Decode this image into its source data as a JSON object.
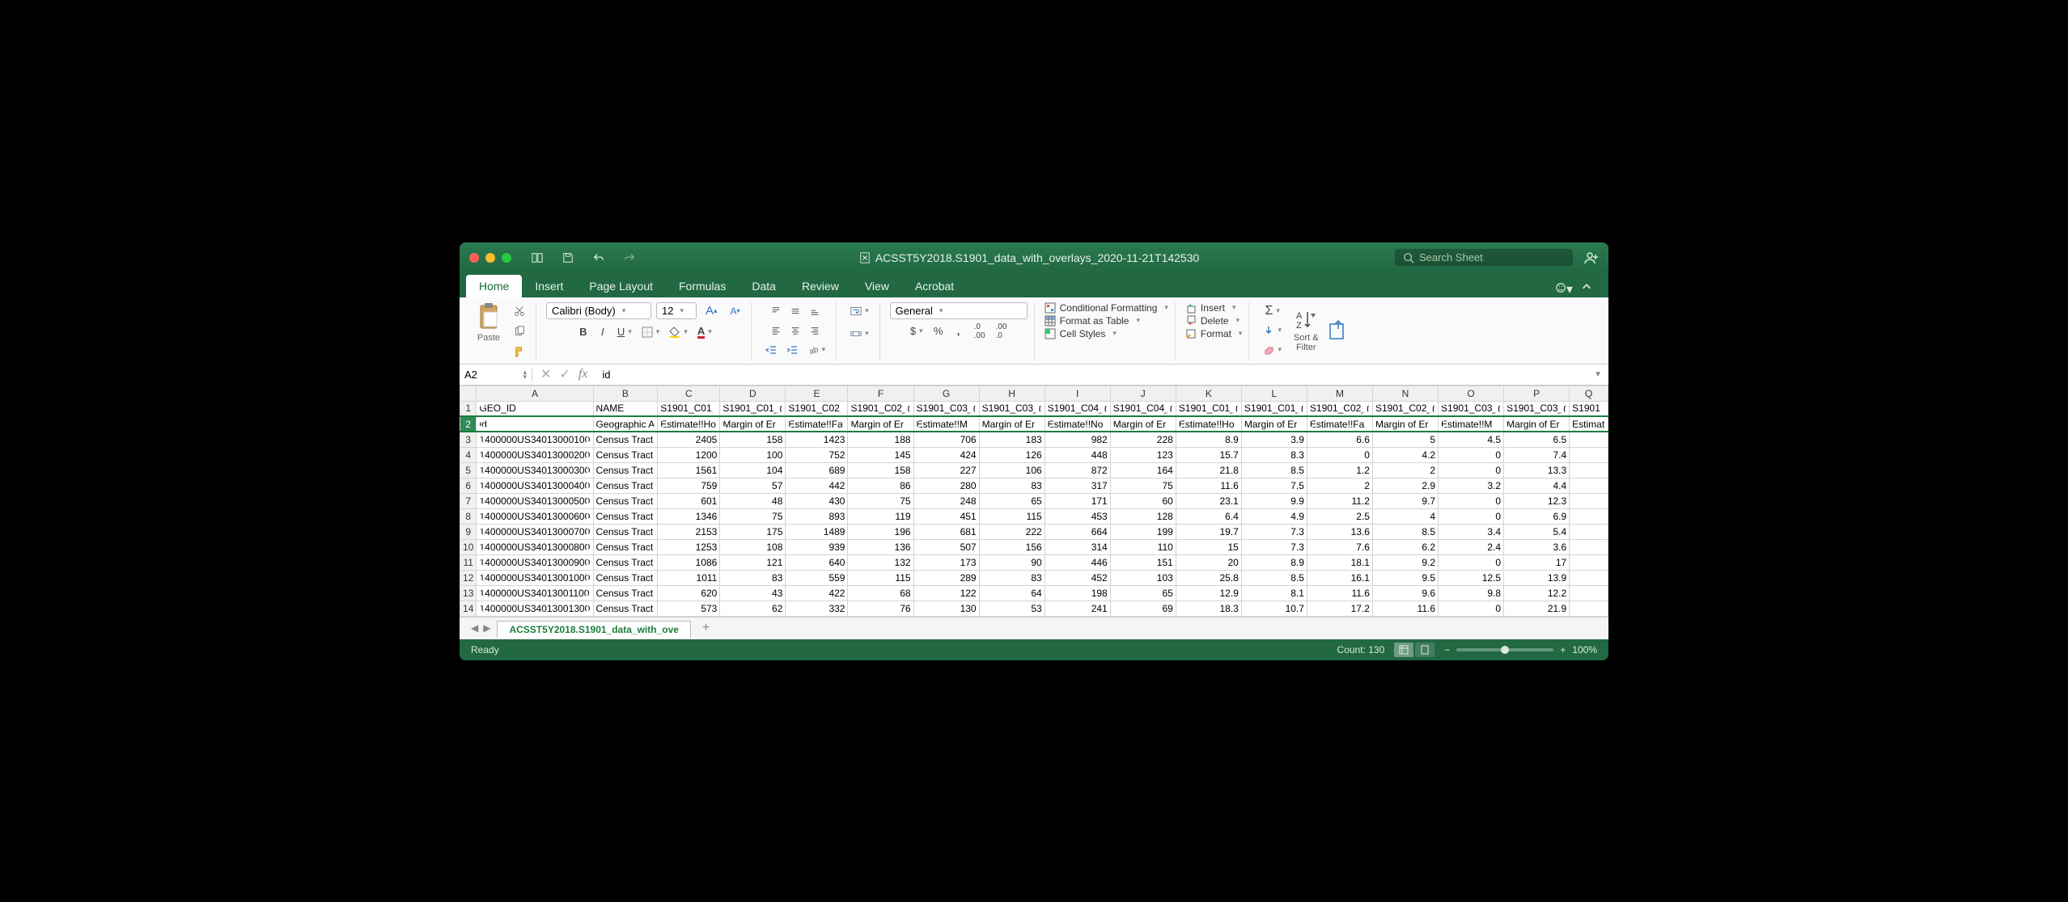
{
  "title": "ACSST5Y2018.S1901_data_with_overlays_2020-11-21T142530",
  "search_placeholder": "Search Sheet",
  "tabs": [
    "Home",
    "Insert",
    "Page Layout",
    "Formulas",
    "Data",
    "Review",
    "View",
    "Acrobat"
  ],
  "active_tab": "Home",
  "clipboard_label": "Paste",
  "font_name": "Calibri (Body)",
  "font_size": "12",
  "number_format": "General",
  "styles": {
    "cond": "Conditional Formatting",
    "table": "Format as Table",
    "cell": "Cell Styles"
  },
  "cell_ops": {
    "ins": "Insert",
    "del": "Delete",
    "fmt": "Format"
  },
  "sort_label": "Sort &\nFilter",
  "cell_ref": "A2",
  "formula_value": "id",
  "columns": [
    "A",
    "B",
    "C",
    "D",
    "E",
    "F",
    "G",
    "H",
    "I",
    "J",
    "K",
    "L",
    "M",
    "N",
    "O",
    "P",
    "Q"
  ],
  "col_widths": {
    "A": 155,
    "B": 80
  },
  "header_row": [
    "GEO_ID",
    "NAME",
    "S1901_C01_",
    "S1901_C01_(",
    "S1901_C02_",
    "S1901_C02_(",
    "S1901_C03_(",
    "S1901_C03_(",
    "S1901_C04_(",
    "S1901_C04_(",
    "S1901_C01_(",
    "S1901_C01_(",
    "S1901_C02_(",
    "S1901_C02_(",
    "S1901_C03_(",
    "S1901_C03_(",
    "S1901"
  ],
  "label_row": [
    "id",
    "Geographic A",
    "Estimate!!Ho",
    "Margin of Er",
    "Estimate!!Fa",
    "Margin of Er",
    "Estimate!!M",
    "Margin of Er",
    "Estimate!!No",
    "Margin of Er",
    "Estimate!!Ho",
    "Margin of Er",
    "Estimate!!Fa",
    "Margin of Er",
    "Estimate!!M",
    "Margin of Er",
    "Estimat"
  ],
  "rows": [
    {
      "n": 3,
      "cells": [
        "1400000US34013000100",
        "Census Tract",
        "2405",
        "158",
        "1423",
        "188",
        "706",
        "183",
        "982",
        "228",
        "8.9",
        "3.9",
        "6.6",
        "5",
        "4.5",
        "6.5",
        ""
      ]
    },
    {
      "n": 4,
      "cells": [
        "1400000US34013000200",
        "Census Tract",
        "1200",
        "100",
        "752",
        "145",
        "424",
        "126",
        "448",
        "123",
        "15.7",
        "8.3",
        "0",
        "4.2",
        "0",
        "7.4",
        ""
      ]
    },
    {
      "n": 5,
      "cells": [
        "1400000US34013000300",
        "Census Tract",
        "1561",
        "104",
        "689",
        "158",
        "227",
        "106",
        "872",
        "164",
        "21.8",
        "8.5",
        "1.2",
        "2",
        "0",
        "13.3",
        ""
      ]
    },
    {
      "n": 6,
      "cells": [
        "1400000US34013000400",
        "Census Tract",
        "759",
        "57",
        "442",
        "86",
        "280",
        "83",
        "317",
        "75",
        "11.6",
        "7.5",
        "2",
        "2.9",
        "3.2",
        "4.4",
        ""
      ]
    },
    {
      "n": 7,
      "cells": [
        "1400000US34013000500",
        "Census Tract",
        "601",
        "48",
        "430",
        "75",
        "248",
        "65",
        "171",
        "60",
        "23.1",
        "9.9",
        "11.2",
        "9.7",
        "0",
        "12.3",
        ""
      ]
    },
    {
      "n": 8,
      "cells": [
        "1400000US34013000600",
        "Census Tract",
        "1346",
        "75",
        "893",
        "119",
        "451",
        "115",
        "453",
        "128",
        "6.4",
        "4.9",
        "2.5",
        "4",
        "0",
        "6.9",
        ""
      ]
    },
    {
      "n": 9,
      "cells": [
        "1400000US34013000700",
        "Census Tract",
        "2153",
        "175",
        "1489",
        "196",
        "681",
        "222",
        "664",
        "199",
        "19.7",
        "7.3",
        "13.6",
        "8.5",
        "3.4",
        "5.4",
        ""
      ]
    },
    {
      "n": 10,
      "cells": [
        "1400000US34013000800",
        "Census Tract",
        "1253",
        "108",
        "939",
        "136",
        "507",
        "156",
        "314",
        "110",
        "15",
        "7.3",
        "7.6",
        "6.2",
        "2.4",
        "3.6",
        ""
      ]
    },
    {
      "n": 11,
      "cells": [
        "1400000US34013000900",
        "Census Tract",
        "1086",
        "121",
        "640",
        "132",
        "173",
        "90",
        "446",
        "151",
        "20",
        "8.9",
        "18.1",
        "9.2",
        "0",
        "17",
        ""
      ]
    },
    {
      "n": 12,
      "cells": [
        "1400000US34013001000",
        "Census Tract",
        "1011",
        "83",
        "559",
        "115",
        "289",
        "83",
        "452",
        "103",
        "25.8",
        "8.5",
        "16.1",
        "9.5",
        "12.5",
        "13.9",
        ""
      ]
    },
    {
      "n": 13,
      "cells": [
        "1400000US34013001100",
        "Census Tract",
        "620",
        "43",
        "422",
        "68",
        "122",
        "64",
        "198",
        "65",
        "12.9",
        "8.1",
        "11.6",
        "9.6",
        "9.8",
        "12.2",
        ""
      ]
    },
    {
      "n": 14,
      "cells": [
        "1400000US34013001300",
        "Census Tract",
        "573",
        "62",
        "332",
        "76",
        "130",
        "53",
        "241",
        "69",
        "18.3",
        "10.7",
        "17.2",
        "11.6",
        "0",
        "21.9",
        ""
      ]
    }
  ],
  "sheet_tab": "ACSST5Y2018.S1901_data_with_ove",
  "status_ready": "Ready",
  "status_count": "Count: 130",
  "zoom": "100%"
}
